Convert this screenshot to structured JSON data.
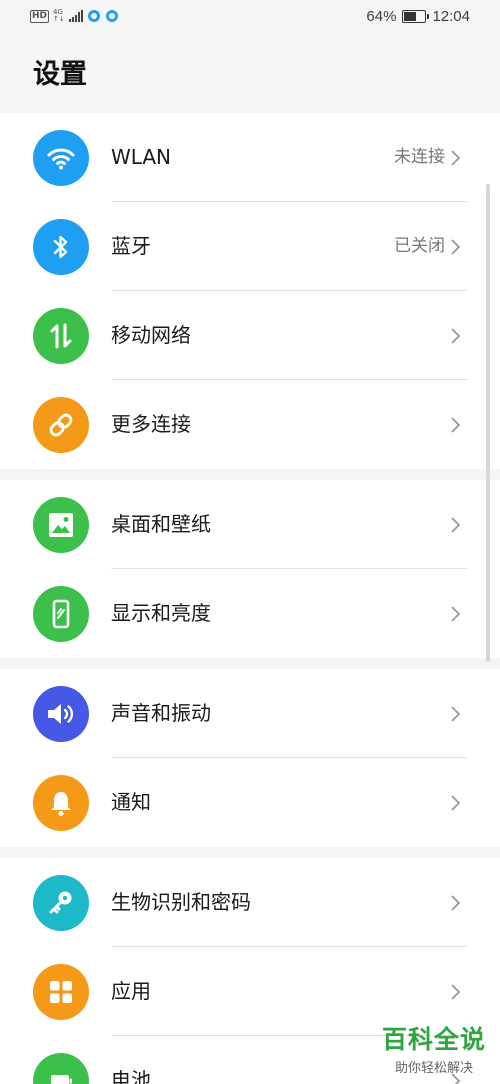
{
  "status_bar": {
    "hd": "HD",
    "net_type": "4G",
    "net_speed": "↑↓",
    "battery_text": "64%",
    "battery_level": 0.64,
    "time": "12:04"
  },
  "page": {
    "title": "设置"
  },
  "groups": [
    {
      "items": [
        {
          "label": "WLAN",
          "value": "未连接",
          "icon": "wifi-icon",
          "color": "#1e9ff2"
        },
        {
          "label": "蓝牙",
          "value": "已关闭",
          "icon": "bluetooth-icon",
          "color": "#1e9ff2"
        },
        {
          "label": "移动网络",
          "value": "",
          "icon": "mobile-data-icon",
          "color": "#3cc04b"
        },
        {
          "label": "更多连接",
          "value": "",
          "icon": "link-icon",
          "color": "#f59a18"
        }
      ]
    },
    {
      "items": [
        {
          "label": "桌面和壁纸",
          "value": "",
          "icon": "image-icon",
          "color": "#3cc04b"
        },
        {
          "label": "显示和亮度",
          "value": "",
          "icon": "display-icon",
          "color": "#3cc04b"
        }
      ]
    },
    {
      "items": [
        {
          "label": "声音和振动",
          "value": "",
          "icon": "speaker-icon",
          "color": "#4558e6"
        },
        {
          "label": "通知",
          "value": "",
          "icon": "bell-icon",
          "color": "#f59a18"
        }
      ]
    },
    {
      "items": [
        {
          "label": "生物识别和密码",
          "value": "",
          "icon": "key-icon",
          "color": "#1eb9c9"
        },
        {
          "label": "应用",
          "value": "",
          "icon": "apps-grid-icon",
          "color": "#f59a18"
        },
        {
          "label": "电池",
          "value": "",
          "icon": "battery-icon",
          "color": "#3cc04b"
        }
      ]
    }
  ],
  "watermark": {
    "main": "百科全说",
    "sub": "助你轻松解决"
  }
}
